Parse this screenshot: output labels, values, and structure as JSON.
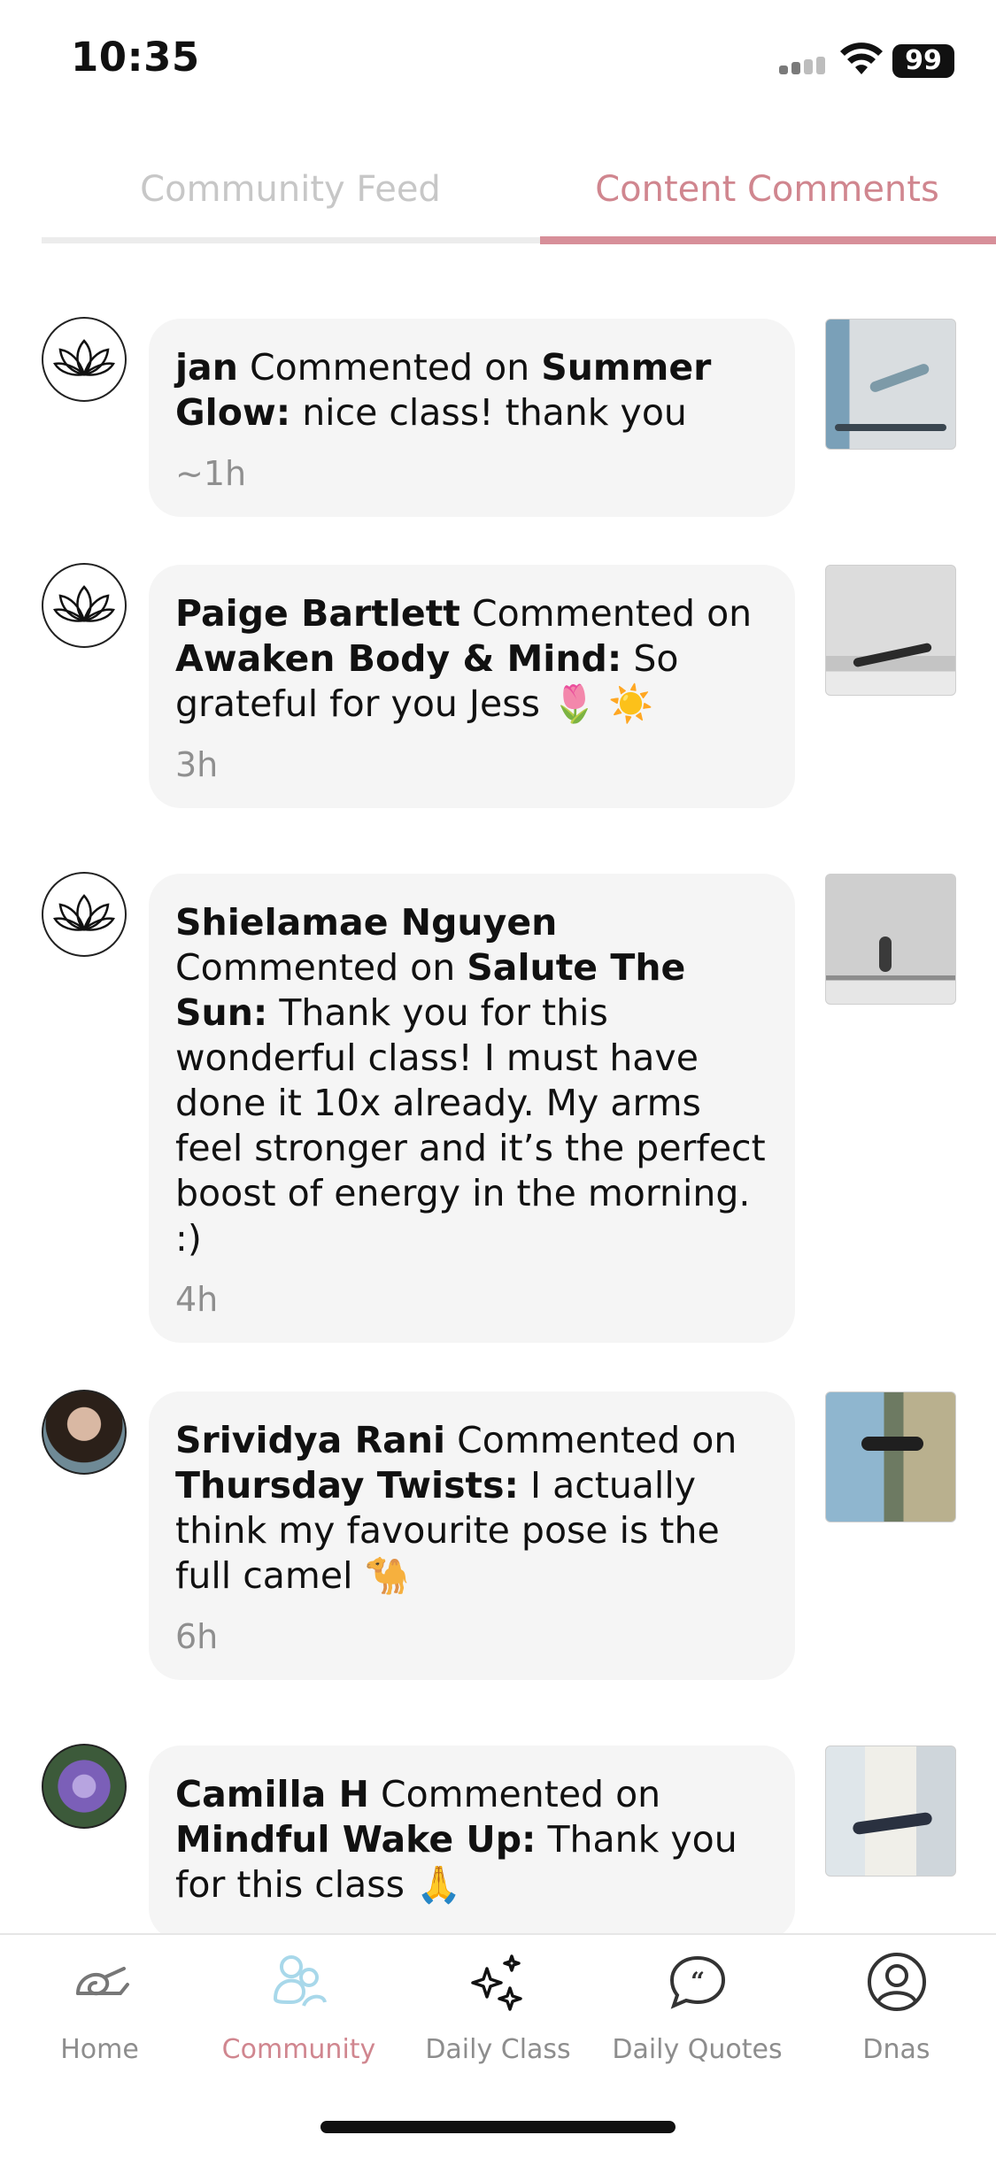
{
  "status_bar": {
    "time": "10:35",
    "battery": "99"
  },
  "tabs": [
    {
      "label": "Community Feed",
      "active": false
    },
    {
      "label": "Content Comments",
      "active": true
    }
  ],
  "comments": [
    {
      "user": "jan",
      "verb": " Commented on ",
      "content": "Summer Glow:",
      "message": " nice class! thank you",
      "time": "~1h",
      "avatar": "lotus-icon"
    },
    {
      "user": "Paige Bartlett",
      "verb": " Commented on ",
      "content": "Awaken Body & Mind:",
      "message": " So grateful for you Jess 🌷 ☀️",
      "time": "3h",
      "avatar": "lotus-icon"
    },
    {
      "user": "Shielamae Nguyen",
      "verb": " Commented on ",
      "content": "Salute The Sun:",
      "message": " Thank you for this wonderful class! I must have done it 10x already. My arms feel stronger and it’s the perfect boost of energy in the morning. :)",
      "time": "4h",
      "avatar": "lotus-icon"
    },
    {
      "user": "Srividya Rani",
      "verb": " Commented on ",
      "content": "Thursday Twists:",
      "message": " I actually think my favourite pose is the full camel 🐪",
      "time": "6h",
      "avatar": "photo"
    },
    {
      "user": "Camilla H",
      "verb": " Commented on ",
      "content": "Mindful Wake Up:",
      "message": " Thank you for this class 🙏",
      "time": "",
      "avatar": "photo"
    }
  ],
  "bottom_nav": [
    {
      "label": "Home",
      "icon": "yoga-mat-icon",
      "active": false
    },
    {
      "label": "Community",
      "icon": "community-icon",
      "active": true
    },
    {
      "label": "Daily Class",
      "icon": "sparkles-icon",
      "active": false
    },
    {
      "label": "Daily Quotes",
      "icon": "quote-bubble-icon",
      "active": false
    },
    {
      "label": "Dnas",
      "icon": "profile-icon",
      "active": false
    }
  ],
  "colors": {
    "accent": "#d78f99",
    "accent_text": "#d0868f",
    "inactive_tab": "#c7c7c7",
    "bubble": "#f5f5f5",
    "nav_active_icon": "#a8d8ea"
  }
}
